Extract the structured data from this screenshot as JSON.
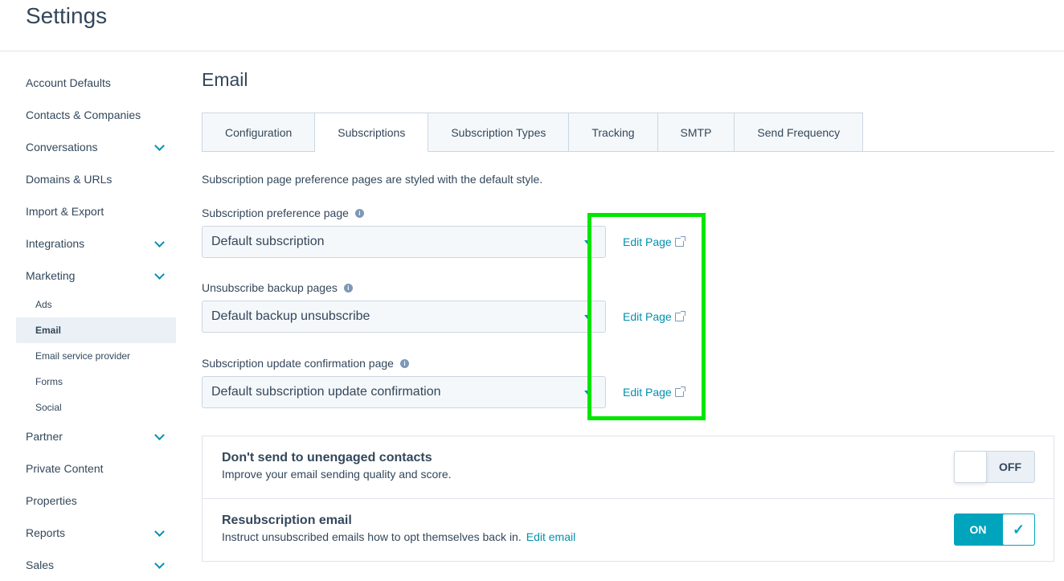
{
  "header": {
    "title": "Settings"
  },
  "sidebar": {
    "items": [
      {
        "label": "Account Defaults",
        "expandable": false
      },
      {
        "label": "Contacts & Companies",
        "expandable": false
      },
      {
        "label": "Conversations",
        "expandable": true
      },
      {
        "label": "Domains & URLs",
        "expandable": false
      },
      {
        "label": "Import & Export",
        "expandable": false
      },
      {
        "label": "Integrations",
        "expandable": true
      },
      {
        "label": "Marketing",
        "expandable": true
      }
    ],
    "marketing_sub": [
      {
        "label": "Ads"
      },
      {
        "label": "Email",
        "active": true
      },
      {
        "label": "Email service provider"
      },
      {
        "label": "Forms"
      },
      {
        "label": "Social"
      }
    ],
    "items_after": [
      {
        "label": "Partner",
        "expandable": true
      },
      {
        "label": "Private Content",
        "expandable": false
      },
      {
        "label": "Properties",
        "expandable": false
      },
      {
        "label": "Reports",
        "expandable": true
      },
      {
        "label": "Sales",
        "expandable": true
      }
    ]
  },
  "main": {
    "title": "Email",
    "tabs": [
      {
        "label": "Configuration"
      },
      {
        "label": "Subscriptions",
        "active": true
      },
      {
        "label": "Subscription Types"
      },
      {
        "label": "Tracking"
      },
      {
        "label": "SMTP"
      },
      {
        "label": "Send Frequency"
      }
    ],
    "description": "Subscription page preference pages are styled with the default style.",
    "fields": [
      {
        "label": "Subscription preference page",
        "value": "Default subscription",
        "link": "Edit Page"
      },
      {
        "label": "Unsubscribe backup pages",
        "value": "Default backup unsubscribe",
        "link": "Edit Page"
      },
      {
        "label": "Subscription update confirmation page",
        "value": "Default subscription update confirmation",
        "link": "Edit Page"
      }
    ],
    "settings": [
      {
        "title": "Don't send to unengaged contacts",
        "description": "Improve your email sending quality and score.",
        "toggle": "OFF"
      },
      {
        "title": "Resubscription email",
        "description": "Instruct unsubscribed emails how to opt themselves back in.",
        "link": "Edit email",
        "toggle": "ON"
      }
    ]
  },
  "colors": {
    "accent": "#0091ae",
    "toggle_on": "#00a4bd",
    "highlight": "#00e600"
  }
}
